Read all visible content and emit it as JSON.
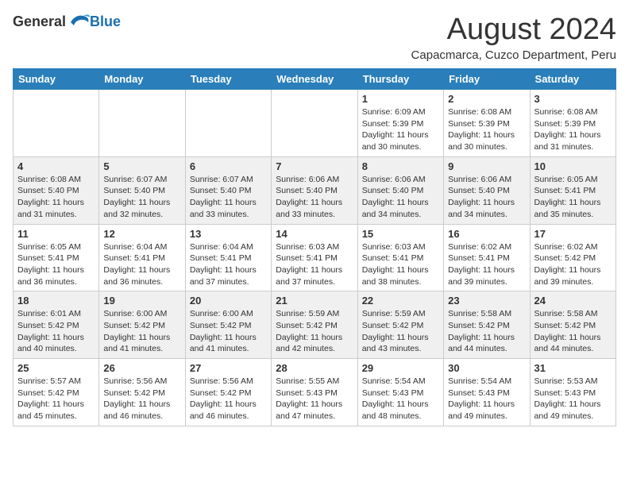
{
  "header": {
    "logo_general": "General",
    "logo_blue": "Blue",
    "month_title": "August 2024",
    "location": "Capacmarca, Cuzco Department, Peru"
  },
  "days_of_week": [
    "Sunday",
    "Monday",
    "Tuesday",
    "Wednesday",
    "Thursday",
    "Friday",
    "Saturday"
  ],
  "weeks": [
    [
      {
        "day": "",
        "info": ""
      },
      {
        "day": "",
        "info": ""
      },
      {
        "day": "",
        "info": ""
      },
      {
        "day": "",
        "info": ""
      },
      {
        "day": "1",
        "info": "Sunrise: 6:09 AM\nSunset: 5:39 PM\nDaylight: 11 hours and 30 minutes."
      },
      {
        "day": "2",
        "info": "Sunrise: 6:08 AM\nSunset: 5:39 PM\nDaylight: 11 hours and 30 minutes."
      },
      {
        "day": "3",
        "info": "Sunrise: 6:08 AM\nSunset: 5:39 PM\nDaylight: 11 hours and 31 minutes."
      }
    ],
    [
      {
        "day": "4",
        "info": "Sunrise: 6:08 AM\nSunset: 5:40 PM\nDaylight: 11 hours and 31 minutes."
      },
      {
        "day": "5",
        "info": "Sunrise: 6:07 AM\nSunset: 5:40 PM\nDaylight: 11 hours and 32 minutes."
      },
      {
        "day": "6",
        "info": "Sunrise: 6:07 AM\nSunset: 5:40 PM\nDaylight: 11 hours and 33 minutes."
      },
      {
        "day": "7",
        "info": "Sunrise: 6:06 AM\nSunset: 5:40 PM\nDaylight: 11 hours and 33 minutes."
      },
      {
        "day": "8",
        "info": "Sunrise: 6:06 AM\nSunset: 5:40 PM\nDaylight: 11 hours and 34 minutes."
      },
      {
        "day": "9",
        "info": "Sunrise: 6:06 AM\nSunset: 5:40 PM\nDaylight: 11 hours and 34 minutes."
      },
      {
        "day": "10",
        "info": "Sunrise: 6:05 AM\nSunset: 5:41 PM\nDaylight: 11 hours and 35 minutes."
      }
    ],
    [
      {
        "day": "11",
        "info": "Sunrise: 6:05 AM\nSunset: 5:41 PM\nDaylight: 11 hours and 36 minutes."
      },
      {
        "day": "12",
        "info": "Sunrise: 6:04 AM\nSunset: 5:41 PM\nDaylight: 11 hours and 36 minutes."
      },
      {
        "day": "13",
        "info": "Sunrise: 6:04 AM\nSunset: 5:41 PM\nDaylight: 11 hours and 37 minutes."
      },
      {
        "day": "14",
        "info": "Sunrise: 6:03 AM\nSunset: 5:41 PM\nDaylight: 11 hours and 37 minutes."
      },
      {
        "day": "15",
        "info": "Sunrise: 6:03 AM\nSunset: 5:41 PM\nDaylight: 11 hours and 38 minutes."
      },
      {
        "day": "16",
        "info": "Sunrise: 6:02 AM\nSunset: 5:41 PM\nDaylight: 11 hours and 39 minutes."
      },
      {
        "day": "17",
        "info": "Sunrise: 6:02 AM\nSunset: 5:42 PM\nDaylight: 11 hours and 39 minutes."
      }
    ],
    [
      {
        "day": "18",
        "info": "Sunrise: 6:01 AM\nSunset: 5:42 PM\nDaylight: 11 hours and 40 minutes."
      },
      {
        "day": "19",
        "info": "Sunrise: 6:00 AM\nSunset: 5:42 PM\nDaylight: 11 hours and 41 minutes."
      },
      {
        "day": "20",
        "info": "Sunrise: 6:00 AM\nSunset: 5:42 PM\nDaylight: 11 hours and 41 minutes."
      },
      {
        "day": "21",
        "info": "Sunrise: 5:59 AM\nSunset: 5:42 PM\nDaylight: 11 hours and 42 minutes."
      },
      {
        "day": "22",
        "info": "Sunrise: 5:59 AM\nSunset: 5:42 PM\nDaylight: 11 hours and 43 minutes."
      },
      {
        "day": "23",
        "info": "Sunrise: 5:58 AM\nSunset: 5:42 PM\nDaylight: 11 hours and 44 minutes."
      },
      {
        "day": "24",
        "info": "Sunrise: 5:58 AM\nSunset: 5:42 PM\nDaylight: 11 hours and 44 minutes."
      }
    ],
    [
      {
        "day": "25",
        "info": "Sunrise: 5:57 AM\nSunset: 5:42 PM\nDaylight: 11 hours and 45 minutes."
      },
      {
        "day": "26",
        "info": "Sunrise: 5:56 AM\nSunset: 5:42 PM\nDaylight: 11 hours and 46 minutes."
      },
      {
        "day": "27",
        "info": "Sunrise: 5:56 AM\nSunset: 5:42 PM\nDaylight: 11 hours and 46 minutes."
      },
      {
        "day": "28",
        "info": "Sunrise: 5:55 AM\nSunset: 5:43 PM\nDaylight: 11 hours and 47 minutes."
      },
      {
        "day": "29",
        "info": "Sunrise: 5:54 AM\nSunset: 5:43 PM\nDaylight: 11 hours and 48 minutes."
      },
      {
        "day": "30",
        "info": "Sunrise: 5:54 AM\nSunset: 5:43 PM\nDaylight: 11 hours and 49 minutes."
      },
      {
        "day": "31",
        "info": "Sunrise: 5:53 AM\nSunset: 5:43 PM\nDaylight: 11 hours and 49 minutes."
      }
    ]
  ]
}
